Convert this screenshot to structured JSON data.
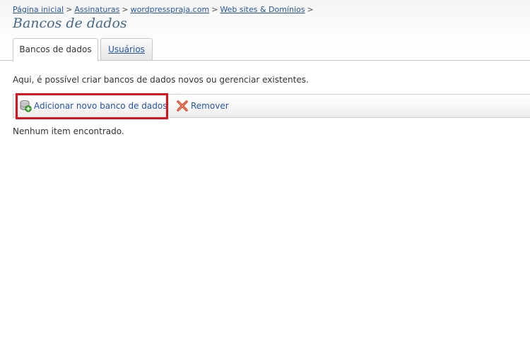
{
  "breadcrumb": {
    "items": [
      "Página inicial",
      "Assinaturas",
      "wordpresspraja.com",
      "Web sites & Domínios"
    ],
    "separator": ">"
  },
  "page": {
    "title": "Bancos de dados"
  },
  "tabs": [
    {
      "label": "Bancos de dados",
      "active": true
    },
    {
      "label": "Usuários",
      "active": false
    }
  ],
  "main": {
    "description": "Aqui, é possível criar bancos de dados novos ou gerenciar existentes.",
    "empty_message": "Nenhum item encontrado."
  },
  "toolbar": {
    "add_label": "Adicionar novo banco de dados",
    "add_icon": "database-add-icon",
    "remove_label": "Remover",
    "remove_icon": "remove-x-icon"
  },
  "colors": {
    "link": "#2455a4",
    "title": "#44688a",
    "highlight": "#e0101a"
  }
}
